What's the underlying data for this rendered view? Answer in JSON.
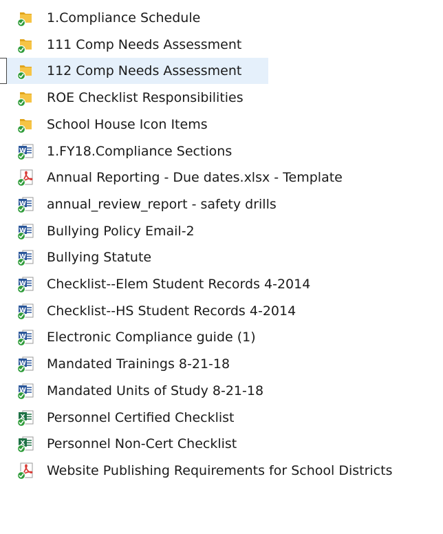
{
  "colors": {
    "folder": "#f6c445",
    "folder_dark": "#e0a41c",
    "sync_green": "#2f9c3a",
    "word_blue": "#2b579a",
    "excel_green": "#1e7145",
    "pdf_red": "#d83a35",
    "selection": "#e5f0fb"
  },
  "files": [
    {
      "name": "1.Compliance Schedule",
      "icon": "folder-icon"
    },
    {
      "name": "111 Comp Needs Assessment",
      "icon": "folder-icon"
    },
    {
      "name": "112 Comp Needs Assessment",
      "icon": "folder-icon",
      "selected": true
    },
    {
      "name": "ROE Checklist Responsibilities",
      "icon": "folder-icon"
    },
    {
      "name": "School House Icon Items",
      "icon": "folder-icon"
    },
    {
      "name": "1.FY18.Compliance Sections",
      "icon": "word-document-icon"
    },
    {
      "name": "Annual Reporting - Due dates.xlsx - Template",
      "icon": "pdf-document-icon"
    },
    {
      "name": "annual_review_report - safety drills",
      "icon": "word-document-icon"
    },
    {
      "name": "Bullying Policy Email-2",
      "icon": "word-document-icon"
    },
    {
      "name": "Bullying Statute",
      "icon": "word-document-icon"
    },
    {
      "name": "Checklist--Elem  Student Records 4-2014",
      "icon": "word-document-icon"
    },
    {
      "name": "Checklist--HS Student Records 4-2014",
      "icon": "word-document-icon"
    },
    {
      "name": "Electronic Compliance guide (1)",
      "icon": "word-document-icon"
    },
    {
      "name": "Mandated Trainings 8-21-18",
      "icon": "word-document-icon"
    },
    {
      "name": "Mandated Units of Study 8-21-18",
      "icon": "word-document-icon"
    },
    {
      "name": "Personnel Certified Checklist",
      "icon": "excel-document-icon"
    },
    {
      "name": "Personnel Non-Cert Checklist",
      "icon": "excel-document-icon"
    },
    {
      "name": "Website  Publishing Requirements for School Districts",
      "icon": "pdf-document-icon"
    }
  ]
}
